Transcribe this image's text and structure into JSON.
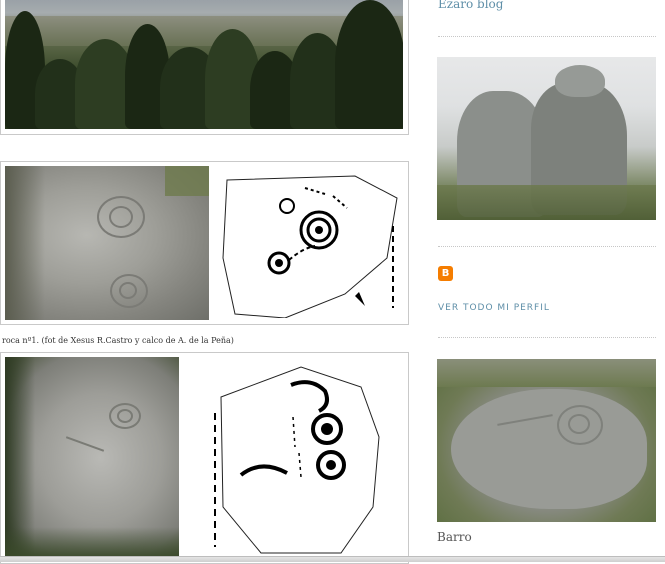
{
  "sidebar": {
    "blog_link": "Ezaro blog",
    "profile_link": "VER TODO MI PERFIL",
    "blogger_icon": "blogger-icon",
    "photo_caption": "Barro"
  },
  "main": {
    "figure_caption": "roca nº1. (fot de Xesus R.Castro y calco de A. de la Peña)"
  },
  "colors": {
    "link": "#5f8fa8",
    "blogger_orange": "#f57d00"
  }
}
